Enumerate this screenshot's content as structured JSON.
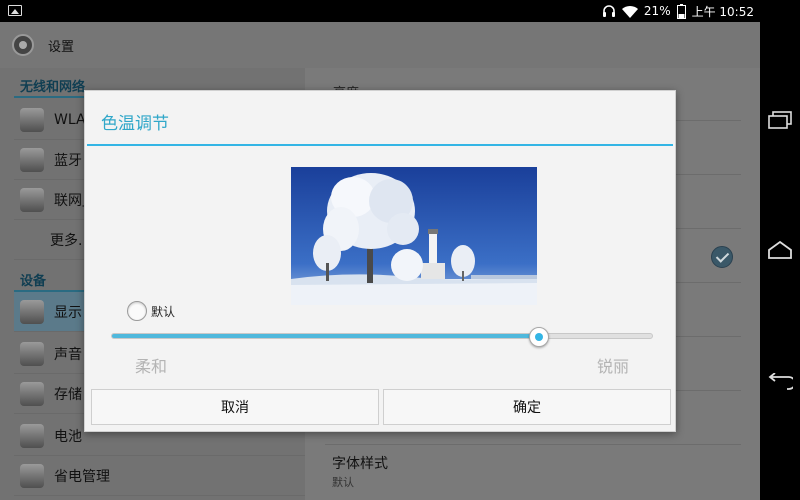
{
  "status_bar": {
    "battery": "21%",
    "time": "上午 10:52",
    "icons": [
      "picture-icon",
      "headphones-icon",
      "wifi-icon",
      "battery-icon"
    ]
  },
  "action_bar": {
    "title": "设置",
    "icon": "settings-icon"
  },
  "sidebar": {
    "sections": [
      "无线和网络",
      "设备"
    ],
    "items": [
      {
        "label": "WLAN",
        "icon": "wifi-icon"
      },
      {
        "label": "蓝牙",
        "icon": "bluetooth-icon"
      },
      {
        "label": "联网」",
        "icon": "network-icon"
      },
      {
        "label": "更多...",
        "icon": ""
      },
      {
        "label": "显示",
        "icon": "display-icon",
        "selected": true
      },
      {
        "label": "声音",
        "icon": "sound-icon"
      },
      {
        "label": "存储",
        "icon": "storage-icon"
      },
      {
        "label": "电池",
        "icon": "battery-icon"
      },
      {
        "label": "省电管理",
        "icon": "power-saving-icon"
      }
    ]
  },
  "detail": {
    "top_text": "亮度",
    "item_title": "字体样式",
    "item_sub": "默认"
  },
  "dialog": {
    "title": "色温调节",
    "default_label": "默认",
    "min_label": "柔和",
    "max_label": "锐丽",
    "slider_value": 0.79,
    "cancel_label": "取消",
    "ok_label": "确定",
    "accent_color": "#33b5e5"
  }
}
